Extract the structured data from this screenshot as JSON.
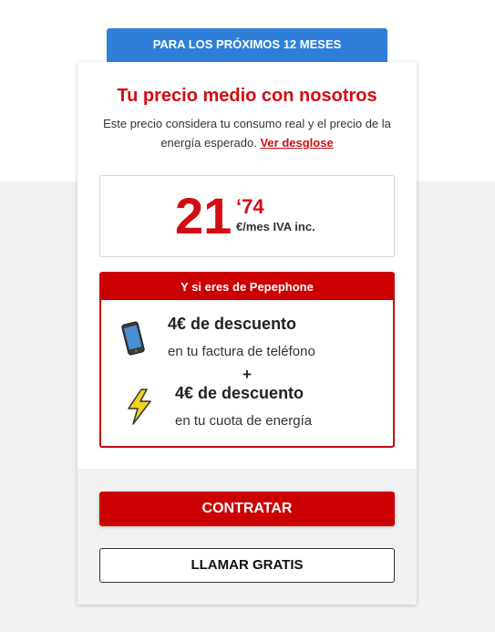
{
  "period_tab": "PARA LOS PRÓXIMOS 12 MESES",
  "card": {
    "title": "Tu precio medio con nosotros",
    "description": "Este precio considera tu consumo real y el precio de la energía esperado.",
    "breakdown_link": "Ver desglose"
  },
  "price": {
    "integer": "21",
    "decimal": "‘74",
    "unit": "€/mes IVA inc."
  },
  "promo": {
    "header": "Y si eres de Pepephone",
    "phone_discount": "4€ de descuento",
    "phone_detail": "en tu factura de teléfono",
    "plus": "+",
    "energy_discount": "4€ de descuento",
    "energy_detail": "en tu cuota de energía",
    "icons": [
      "phone-icon",
      "lightning-icon"
    ]
  },
  "buttons": {
    "contract": "CONTRATAR",
    "call": "LLAMAR GRATIS"
  },
  "colors": {
    "brand_red": "#cc0000",
    "tab_blue": "#2f7fd9"
  }
}
